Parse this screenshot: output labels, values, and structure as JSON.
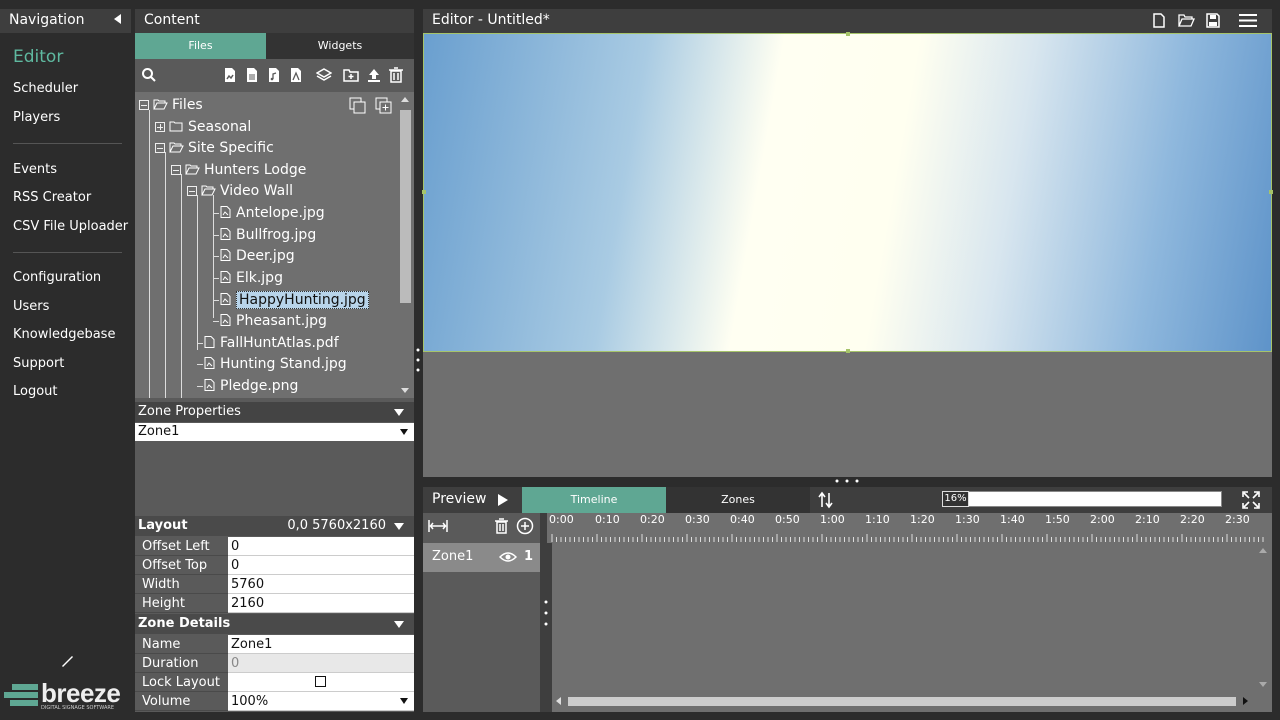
{
  "nav": {
    "title": "Navigation",
    "items": [
      {
        "label": "Editor",
        "active": true
      },
      {
        "label": "Scheduler"
      },
      {
        "label": "Players"
      },
      {
        "label": "Events"
      },
      {
        "label": "RSS Creator"
      },
      {
        "label": "CSV File Uploader"
      },
      {
        "label": "Configuration"
      },
      {
        "label": "Users"
      },
      {
        "label": "Knowledgebase"
      },
      {
        "label": "Support"
      },
      {
        "label": "Logout"
      }
    ],
    "logo_text": "breeze",
    "logo_tagline": "DIGITAL SIGNAGE SOFTWARE"
  },
  "content": {
    "title": "Content",
    "tabs": [
      "Files",
      "Widgets"
    ],
    "tree": [
      {
        "label": "Files",
        "type": "folder-open",
        "expander": "minus"
      },
      {
        "label": "Seasonal",
        "type": "folder",
        "expander": "plus"
      },
      {
        "label": "Site Specific",
        "type": "folder-open",
        "expander": "minus"
      },
      {
        "label": "Hunters Lodge",
        "type": "folder-open",
        "expander": "minus"
      },
      {
        "label": "Video Wall",
        "type": "folder-open",
        "expander": "minus"
      },
      {
        "label": "Antelope.jpg",
        "type": "image"
      },
      {
        "label": "Bullfrog.jpg",
        "type": "image"
      },
      {
        "label": "Deer.jpg",
        "type": "image"
      },
      {
        "label": "Elk.jpg",
        "type": "image"
      },
      {
        "label": "HappyHunting.jpg",
        "type": "image",
        "selected": true
      },
      {
        "label": "Pheasant.jpg",
        "type": "image"
      },
      {
        "label": "FallHuntAtlas.pdf",
        "type": "doc"
      },
      {
        "label": "Hunting Stand.jpg",
        "type": "image"
      },
      {
        "label": "Pledge.png",
        "type": "image"
      }
    ]
  },
  "zone_properties": {
    "title": "Zone Properties",
    "selected_zone": "Zone1"
  },
  "layout": {
    "title": "Layout",
    "summary": "0,0  5760x2160",
    "rows": [
      {
        "label": "Offset Left",
        "value": "0"
      },
      {
        "label": "Offset Top",
        "value": "0"
      },
      {
        "label": "Width",
        "value": "5760"
      },
      {
        "label": "Height",
        "value": "2160"
      }
    ]
  },
  "zone_details": {
    "title": "Zone Details",
    "name_label": "Name",
    "name_value": "Zone1",
    "duration_label": "Duration",
    "duration_value": "0",
    "lock_label": "Lock Layout",
    "lock_checked": false,
    "volume_label": "Volume",
    "volume_value": "100%"
  },
  "editor": {
    "title": "Editor - Untitled*"
  },
  "preview": {
    "title": "Preview",
    "tabs": [
      "Timeline",
      "Zones"
    ],
    "zoom": "16%",
    "ticks": [
      "0:00",
      "0:10",
      "0:20",
      "0:30",
      "0:40",
      "0:50",
      "1:00",
      "1:10",
      "1:20",
      "1:30",
      "1:40",
      "1:50",
      "2:00",
      "2:10",
      "2:20",
      "2:30"
    ],
    "zone_name": "Zone1",
    "zone_count": "1"
  }
}
